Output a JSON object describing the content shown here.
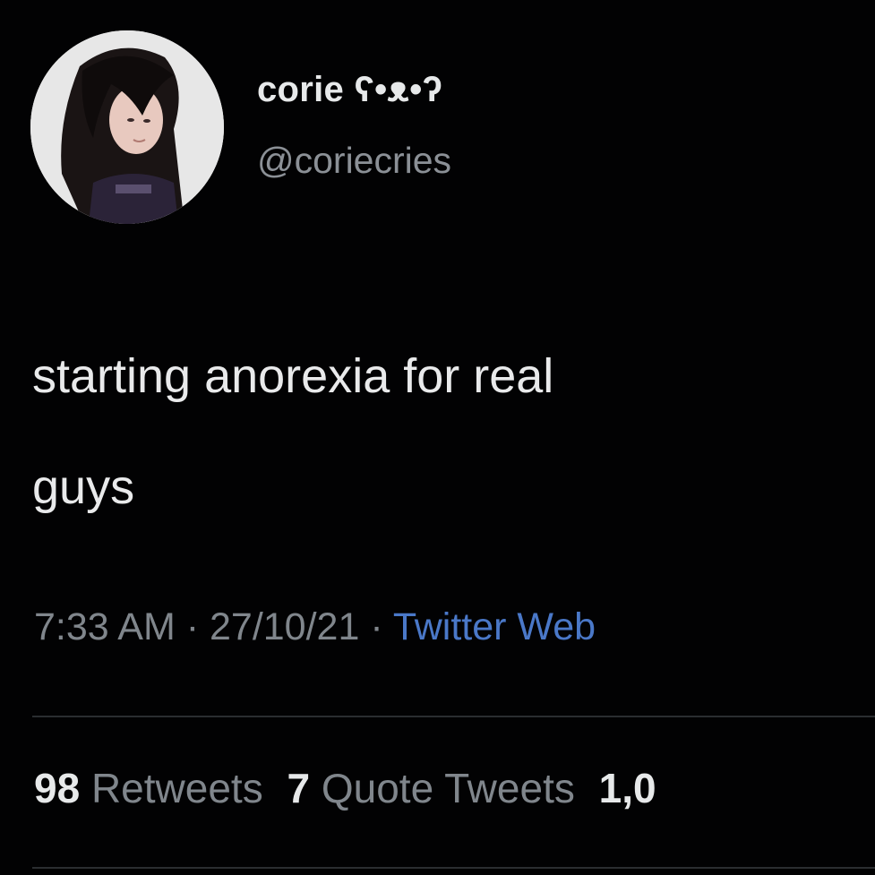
{
  "user": {
    "display_name": "corie ʕ•ᴥ•ʔ",
    "handle": "@coriecries",
    "avatar": "profile-photo"
  },
  "tweet": {
    "text_lines": [
      "starting anorexia for real",
      "guys"
    ]
  },
  "meta": {
    "time": "7:33 AM",
    "separator1": " · ",
    "date": "27/10/21",
    "separator2": " · ",
    "source": "Twitter Web"
  },
  "stats": {
    "retweets_count": "98",
    "retweets_label": "Retweets",
    "quotes_count": "7",
    "quotes_label": "Quote Tweets",
    "likes_count": "1,0"
  },
  "colors": {
    "background": "#020203",
    "text": "#e7e9ea",
    "secondary": "#80868c",
    "link": "#4a78c8",
    "divider": "#2a2d30"
  }
}
